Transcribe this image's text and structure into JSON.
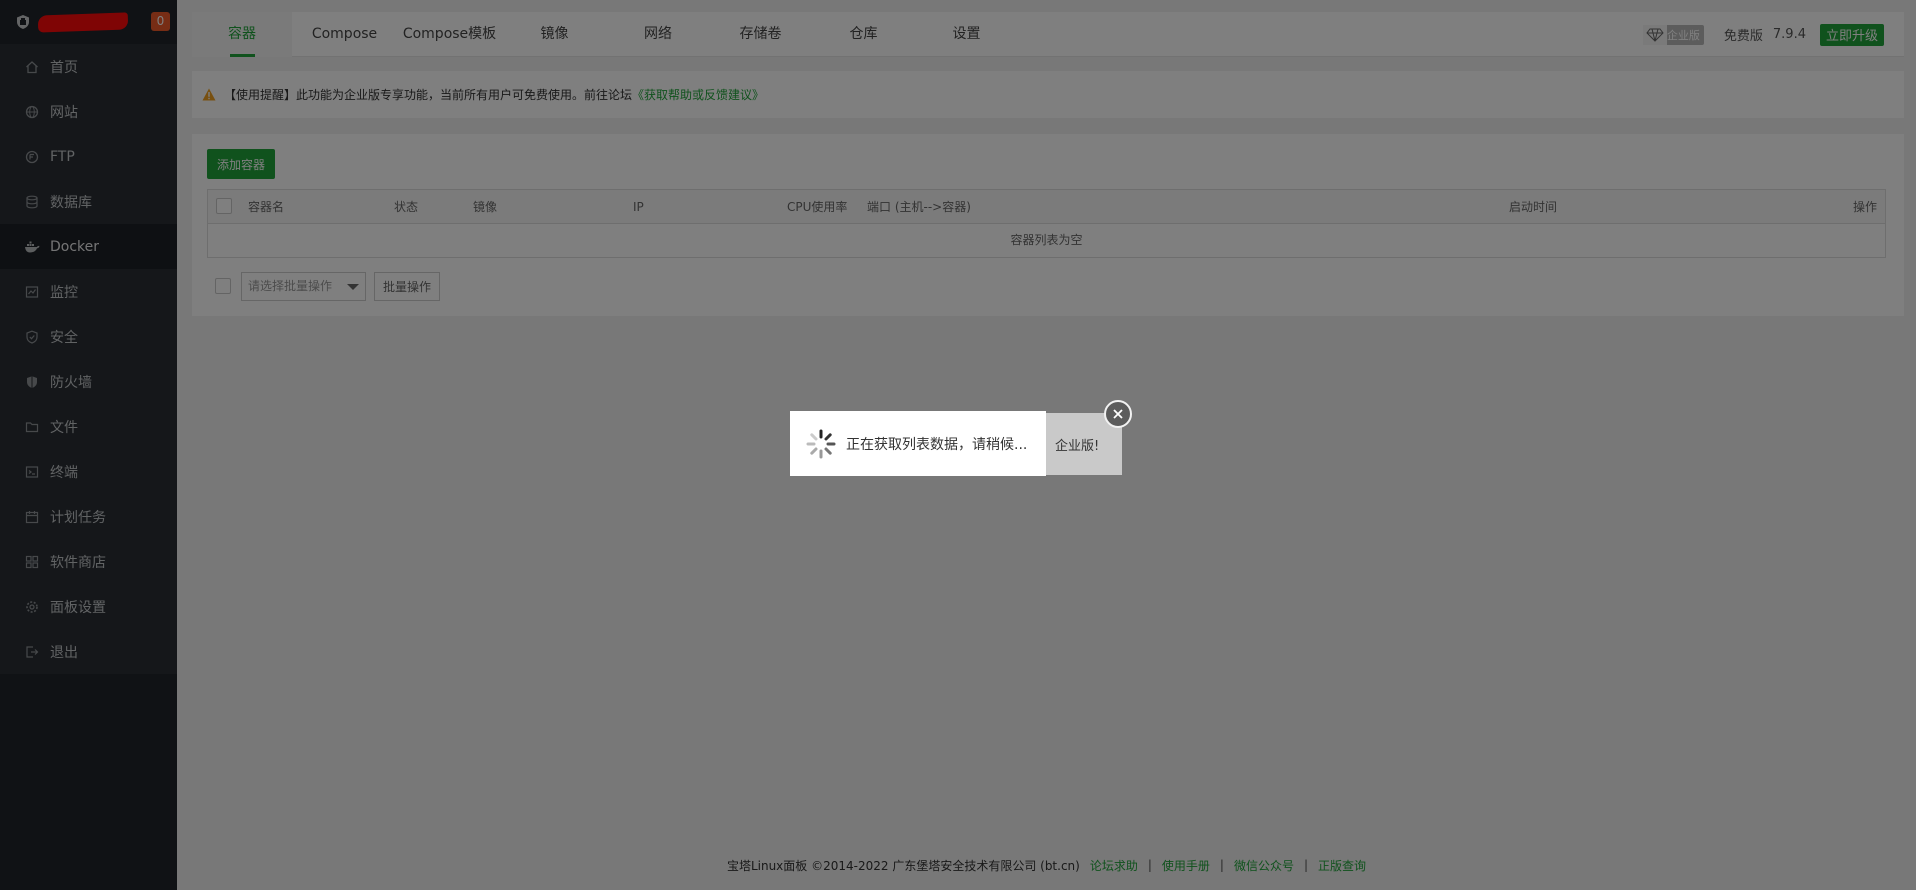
{
  "sidebar": {
    "badge": "0",
    "items": [
      {
        "label": "首页",
        "icon": "home-icon"
      },
      {
        "label": "网站",
        "icon": "globe-icon"
      },
      {
        "label": "FTP",
        "icon": "ftp-icon"
      },
      {
        "label": "数据库",
        "icon": "database-icon"
      },
      {
        "label": "Docker",
        "icon": "docker-icon",
        "active": true
      },
      {
        "label": "监控",
        "icon": "monitor-icon"
      },
      {
        "label": "安全",
        "icon": "shield-icon"
      },
      {
        "label": "防火墙",
        "icon": "firewall-icon"
      },
      {
        "label": "文件",
        "icon": "folder-icon"
      },
      {
        "label": "终端",
        "icon": "terminal-icon"
      },
      {
        "label": "计划任务",
        "icon": "calendar-icon"
      },
      {
        "label": "软件商店",
        "icon": "apps-icon"
      },
      {
        "label": "面板设置",
        "icon": "gear-icon"
      },
      {
        "label": "退出",
        "icon": "logout-icon"
      }
    ]
  },
  "tabs": [
    {
      "label": "容器",
      "active": true
    },
    {
      "label": "Compose"
    },
    {
      "label": "Compose模板"
    },
    {
      "label": "镜像"
    },
    {
      "label": "网络"
    },
    {
      "label": "存储卷"
    },
    {
      "label": "仓库"
    },
    {
      "label": "设置"
    }
  ],
  "header": {
    "enterprise_badge": "企业版",
    "free_edition": "免费版",
    "version": "7.9.4",
    "upgrade": "立即升级"
  },
  "notice": {
    "text": "【使用提醒】此功能为企业版专享功能，当前所有用户可免费使用。前往论坛",
    "link": "《获取帮助或反馈建议》"
  },
  "container": {
    "add_button": "添加容器",
    "columns": {
      "name": "容器名",
      "status": "状态",
      "image": "镜像",
      "ip": "IP",
      "cpu": "CPU使用率",
      "port": "端口 (主机-->容器)",
      "start_time": "启动时间",
      "action": "操作"
    },
    "empty": "容器列表为空",
    "batch_placeholder": "请选择批量操作",
    "batch_button": "批量操作"
  },
  "footer": {
    "copyright": "宝塔Linux面板 ©2014-2022 广东堡塔安全技术有限公司 (bt.cn)",
    "links": [
      "论坛求助",
      "使用手册",
      "微信公众号",
      "正版查询"
    ]
  },
  "overlay": {
    "loading_text": "正在获取列表数据，请稍候...",
    "behind_toast": "企业版!"
  },
  "colors": {
    "accent": "#20a53a",
    "sidebar_bg": "#20252b",
    "badge": "#ef5b2a"
  }
}
